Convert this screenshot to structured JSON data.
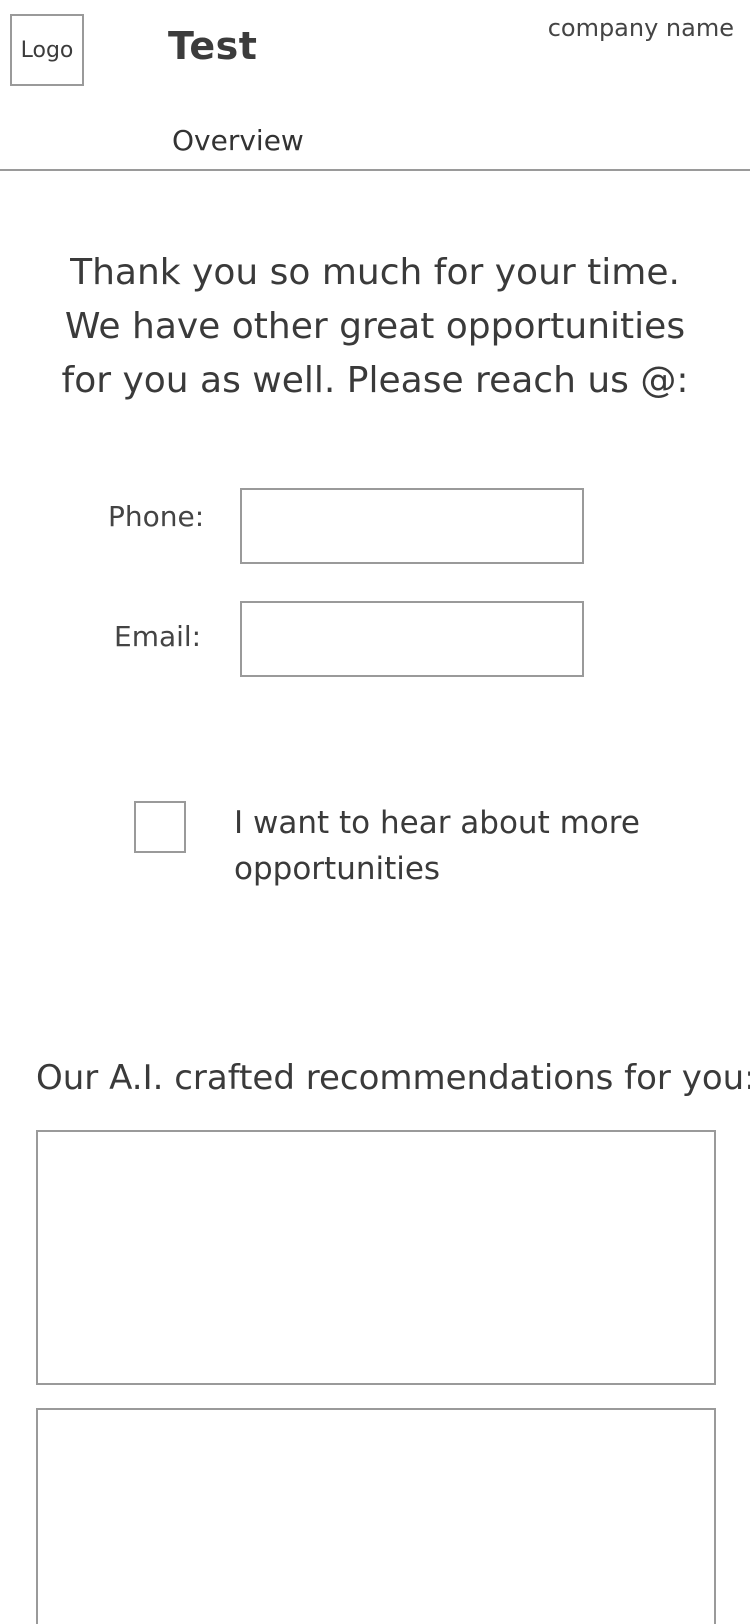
{
  "header": {
    "logo_label": "Logo",
    "app_title": "Test",
    "company_name": "company name",
    "nav_tab": "Overview"
  },
  "main": {
    "message": "Thank you so much for your time. We have other great opportunities for you as well. Please reach us @:",
    "phone": {
      "label": "Phone:",
      "value": ""
    },
    "email": {
      "label": "Email:",
      "value": ""
    },
    "opt_in": {
      "label": "I want to hear about more opportunities",
      "checked": false
    },
    "recommendations": {
      "heading": "Our A.I. crafted recommendations for you:"
    }
  },
  "colors": {
    "text": "#3c3c3c",
    "border": "#9a9a9a",
    "background": "#ffffff"
  }
}
